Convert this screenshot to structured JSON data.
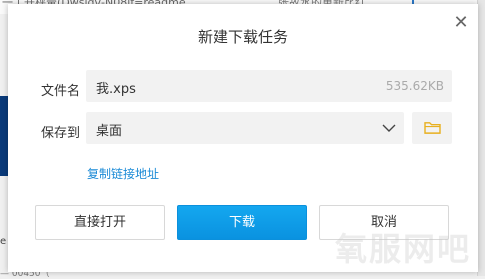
{
  "background": {
    "top_fragment_left": "一丨开枰彙(Dwsldv‐N08if=readme",
    "top_fragment_right": "张故水的重新比红",
    "left_char": "e",
    "bottom_fragment": "— 00450（"
  },
  "dialog": {
    "title": "新建下载任务",
    "close_glyph": "✕",
    "filename_label": "文件名",
    "filename_value": "我.xps",
    "file_size": "535.62KB",
    "save_to_label": "保存到",
    "save_to_value": "桌面",
    "copy_link": "复制链接地址",
    "open_button": "直接打开",
    "download_button": "下载",
    "cancel_button": "取消"
  },
  "watermark": "氧服网吧",
  "colors": {
    "accent": "#0a92e0",
    "link": "#1a8ad6",
    "folder": "#e8b020"
  },
  "icons": {
    "close": "close-icon",
    "dropdown": "chevron-down-icon",
    "folder": "folder-icon"
  }
}
